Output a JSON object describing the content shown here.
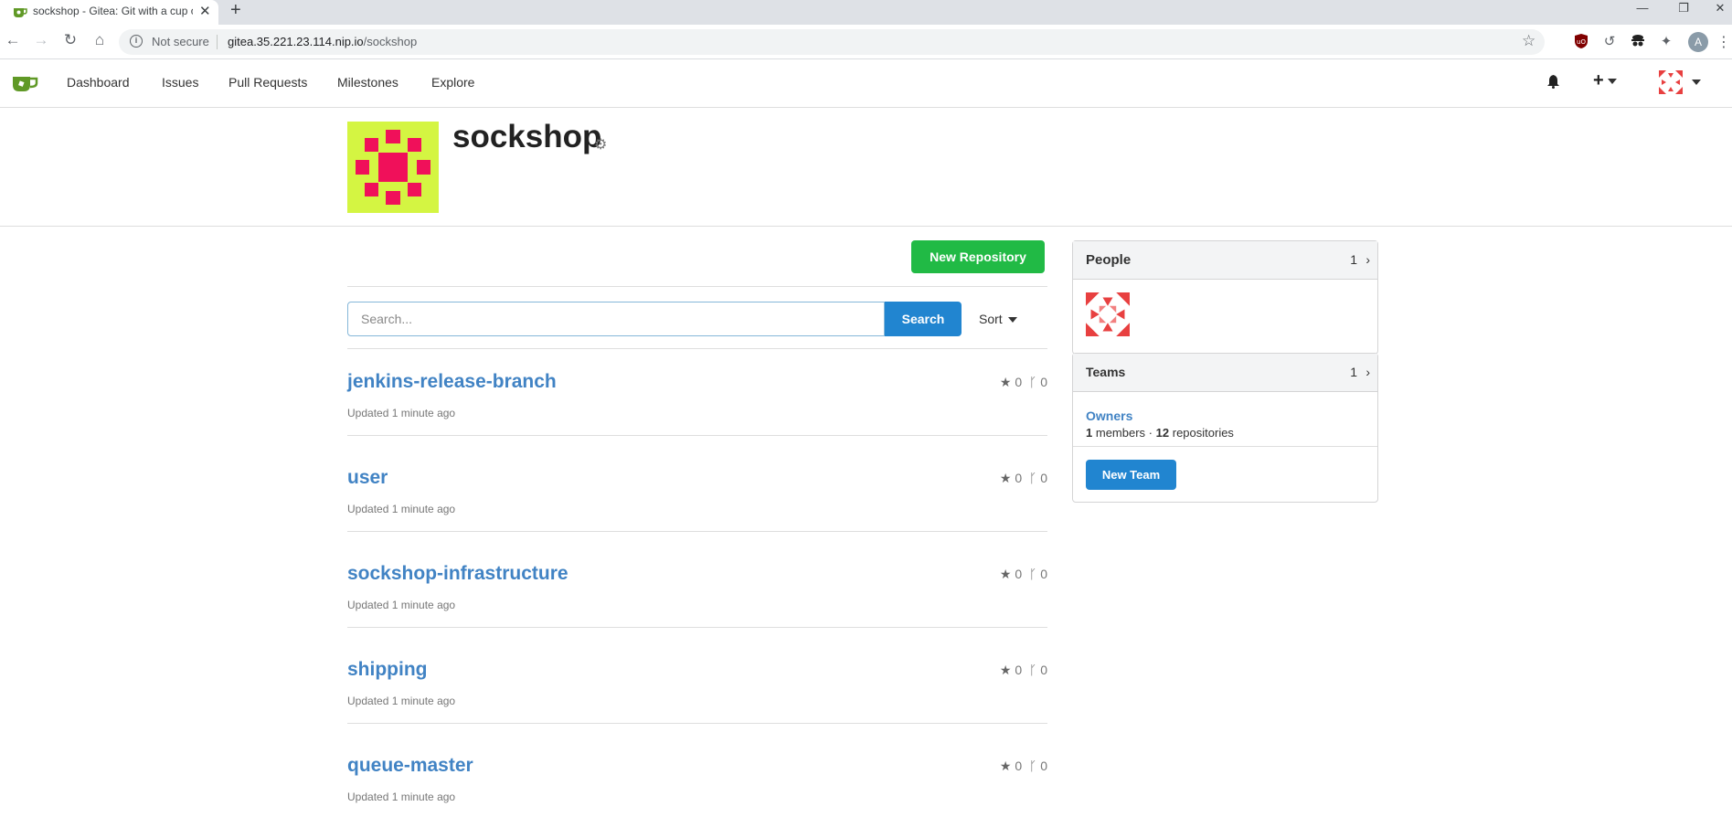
{
  "browser": {
    "tab_title": "sockshop - Gitea: Git with a cup of tea",
    "url_security": "Not secure",
    "url_host": "gitea.35.221.23.114.nip.io",
    "url_path": "/sockshop",
    "profile_initial": "A"
  },
  "nav": {
    "items": [
      "Dashboard",
      "Issues",
      "Pull Requests",
      "Milestones",
      "Explore"
    ]
  },
  "org": {
    "name": "sockshop",
    "avatar_color": "#d4f542",
    "avatar_accent": "#f0105a"
  },
  "repos": {
    "new_button": "New Repository",
    "search_placeholder": "Search...",
    "search_button": "Search",
    "sort_label": "Sort",
    "items": [
      {
        "name": "jenkins-release-branch",
        "updated": "Updated 1 minute ago",
        "stars": "0",
        "forks": "0"
      },
      {
        "name": "user",
        "updated": "Updated 1 minute ago",
        "stars": "0",
        "forks": "0"
      },
      {
        "name": "sockshop-infrastructure",
        "updated": "Updated 1 minute ago",
        "stars": "0",
        "forks": "0"
      },
      {
        "name": "shipping",
        "updated": "Updated 1 minute ago",
        "stars": "0",
        "forks": "0"
      },
      {
        "name": "queue-master",
        "updated": "Updated 1 minute ago",
        "stars": "0",
        "forks": "0"
      }
    ]
  },
  "sidebar": {
    "people": {
      "title": "People",
      "count": "1"
    },
    "teams": {
      "title": "Teams",
      "count": "1",
      "team_name": "Owners",
      "members_count": "1",
      "members_label": "members",
      "separator": "·",
      "repos_count": "12",
      "repos_label": "repositories",
      "new_team_button": "New Team"
    }
  }
}
